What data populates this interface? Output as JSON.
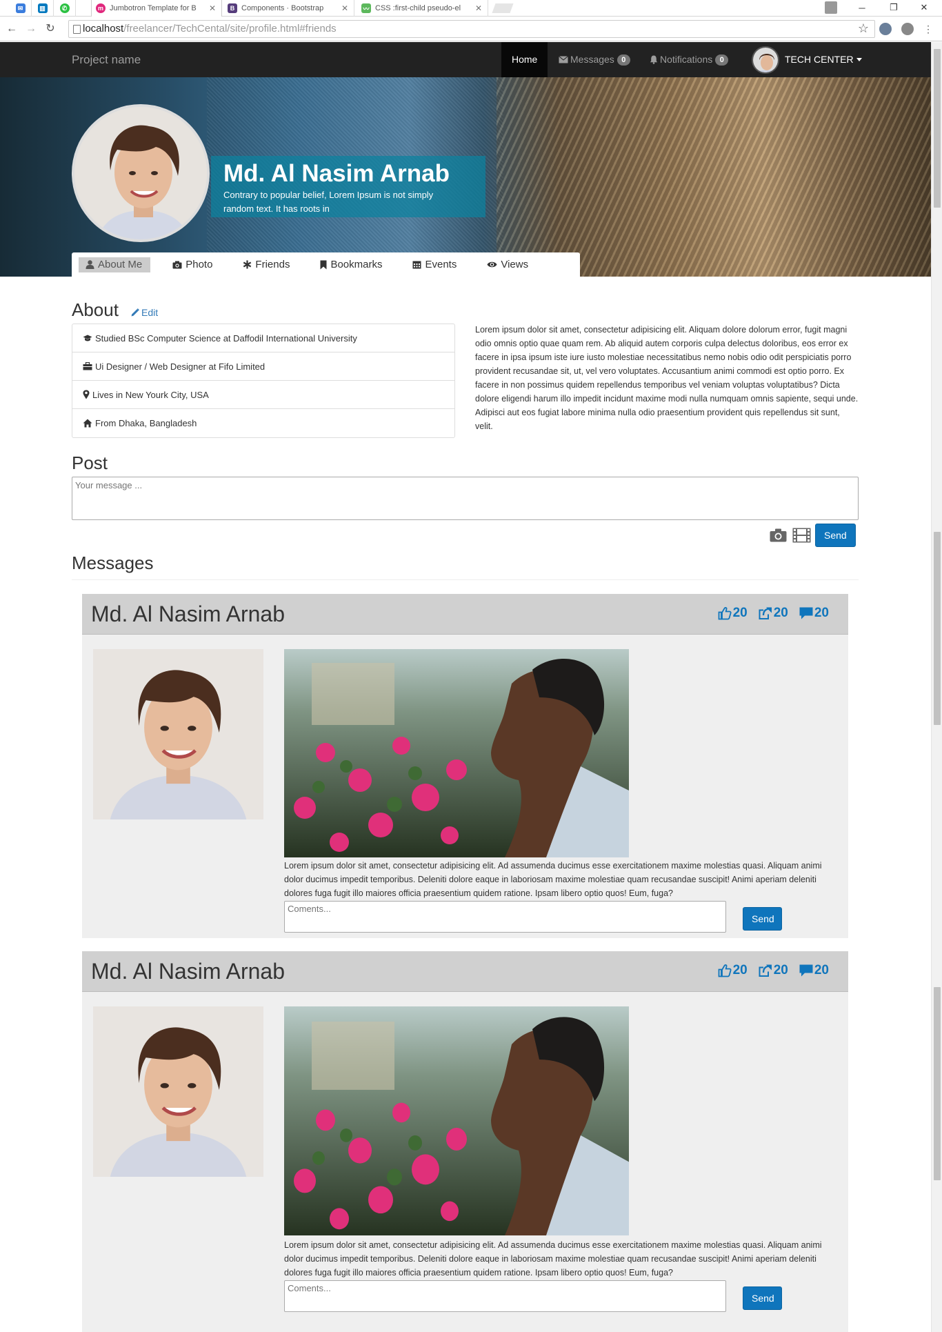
{
  "browser": {
    "tabs": [
      {
        "label": "",
        "icon": "mail-icon",
        "color": "#3b7ddd",
        "pinned": true
      },
      {
        "label": "",
        "icon": "trello-icon",
        "color": "#0079bf",
        "pinned": true
      },
      {
        "label": "",
        "icon": "whatsapp-icon",
        "color": "#2cc143",
        "pinned": true
      },
      {
        "label": "Jumbotron Template for B",
        "icon": "site-icon",
        "color": "#e0287d",
        "active": true
      },
      {
        "label": "Components · Bootstrap",
        "icon": "bootstrap-icon",
        "color": "#563d7c"
      },
      {
        "label": "CSS :first-child pseudo-el",
        "icon": "chart-icon",
        "color": "#5cb85c"
      }
    ],
    "url_prefix": "localhost",
    "url_path": "/freelancer/TechCental/site/profile.html#friends",
    "window_controls": {
      "minimize": "─",
      "restore": "❐",
      "close": "✕"
    }
  },
  "navbar": {
    "brand": "Project name",
    "home": "Home",
    "messages_label": "Messages",
    "messages_count": "0",
    "notifications_label": "Notifications",
    "notifications_count": "0",
    "user_label": "TECH CENTER"
  },
  "profile": {
    "name": "Md. Al Nasim Arnab",
    "tagline": "Contrary to popular belief, Lorem Ipsum is not simply random text. It has roots in",
    "tabs": [
      {
        "label": "About Me",
        "icon": "user-icon",
        "active": true
      },
      {
        "label": "Photo",
        "icon": "camera-icon"
      },
      {
        "label": "Friends",
        "icon": "asterisk-icon"
      },
      {
        "label": "Bookmarks",
        "icon": "bookmark-icon"
      },
      {
        "label": "Events",
        "icon": "calendar-icon"
      },
      {
        "label": "Views",
        "icon": "eye-icon"
      }
    ]
  },
  "about": {
    "title": "About",
    "edit_label": "Edit",
    "items": [
      {
        "text": "Studied BSc Computer Science at Daffodil International University",
        "icon": "education-icon"
      },
      {
        "text": "Ui Designer / Web Designer at Fifo Limited",
        "icon": "briefcase-icon"
      },
      {
        "text": "Lives in New Yourk City, USA",
        "icon": "map-marker-icon"
      },
      {
        "text": "From Dhaka, Bangladesh",
        "icon": "home-icon"
      }
    ],
    "description": "Lorem ipsum dolor sit amet, consectetur adipisicing elit. Aliquam dolore dolorum error, fugit magni odio omnis optio quae quam rem. Ab aliquid autem corporis culpa delectus doloribus, eos error ex facere in ipsa ipsum iste iure iusto molestiae necessitatibus nemo nobis odio odit perspiciatis porro provident recusandae sit, ut, vel vero voluptates. Accusantium animi commodi est optio porro. Ex facere in non possimus quidem repellendus temporibus vel veniam voluptas voluptatibus? Dicta dolore eligendi harum illo impedit incidunt maxime modi nulla numquam omnis sapiente, sequi unde. Adipisci aut eos fugiat labore minima nulla odio praesentium provident quis repellendus sit sunt, velit."
  },
  "post": {
    "title": "Post",
    "placeholder": "Your message ...",
    "send_label": "Send"
  },
  "messages": {
    "title": "Messages",
    "items": [
      {
        "author": "Md. Al Nasim Arnab",
        "likes": "20",
        "shares": "20",
        "comments": "20",
        "text": "Lorem ipsum dolor sit amet, consectetur adipisicing elit. Ad assumenda ducimus esse exercitationem maxime molestias quasi. Aliquam animi dolor ducimus impedit temporibus. Deleniti dolore eaque in laboriosam maxime molestiae quam recusandae suscipit! Animi aperiam deleniti dolores fuga fugit illo maiores officia praesentium quidem ratione. Ipsam libero optio quos! Eum, fuga?",
        "comment_placeholder": "Coments...",
        "send_label": "Send"
      },
      {
        "author": "Md. Al Nasim Arnab",
        "likes": "20",
        "shares": "20",
        "comments": "20",
        "text": "Lorem ipsum dolor sit amet, consectetur adipisicing elit. Ad assumenda ducimus esse exercitationem maxime molestias quasi. Aliquam animi dolor ducimus impedit temporibus. Deleniti dolore eaque in laboriosam maxime molestiae quam recusandae suscipit! Animi aperiam deleniti dolores fuga fugit illo maiores officia praesentium quidem ratione. Ipsam libero optio quos! Eum, fuga?",
        "comment_placeholder": "Coments...",
        "send_label": "Send"
      }
    ]
  },
  "colors": {
    "accent": "#0f75bc",
    "navbar": "#222222",
    "name_overlay": "#0b82a0"
  }
}
